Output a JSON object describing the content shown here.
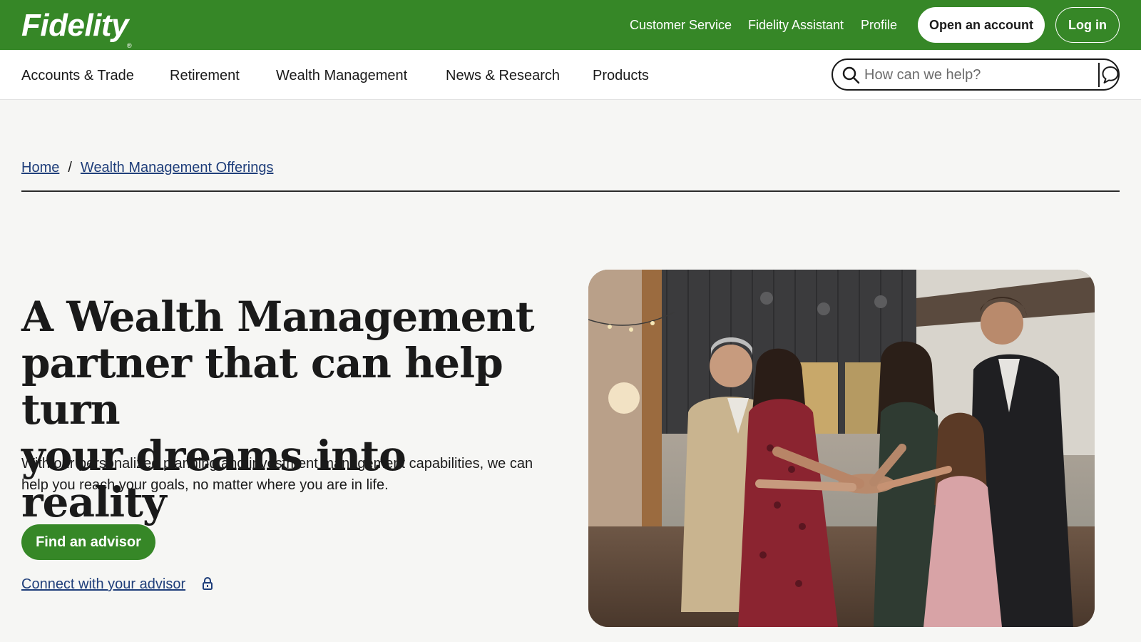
{
  "header": {
    "logo_text": "Fidelity",
    "logo_mark": "®",
    "links": [
      "Customer Service",
      "Fidelity Assistant",
      "Profile"
    ],
    "open_account_label": "Open an account",
    "login_label": "Log in",
    "brand_color": "#368727"
  },
  "nav": {
    "items": [
      "Accounts & Trade",
      "Retirement",
      "Wealth Management",
      "News & Research",
      "Products"
    ],
    "search": {
      "placeholder": "How can we help?",
      "value": "",
      "icon": "search-icon",
      "assistant_icon": "chat-bubble-icon"
    }
  },
  "breadcrumb": {
    "home": "Home",
    "separator": "/",
    "current": "Wealth Management Offerings"
  },
  "hero": {
    "title_lines": [
      "A Wealth Management",
      "partner that can help turn",
      "your dreams into reality"
    ],
    "body": "With our personalized planning and investment management capabilities, we can help you reach your goals, no matter where you are in life.",
    "cta_label": "Find an advisor",
    "secondary_link": "Connect with your advisor",
    "secondary_icon": "lock-icon",
    "image_subject": "family-celebration-photo"
  },
  "colors": {
    "link": "#1f3e7a",
    "background": "#f6f6f4"
  }
}
